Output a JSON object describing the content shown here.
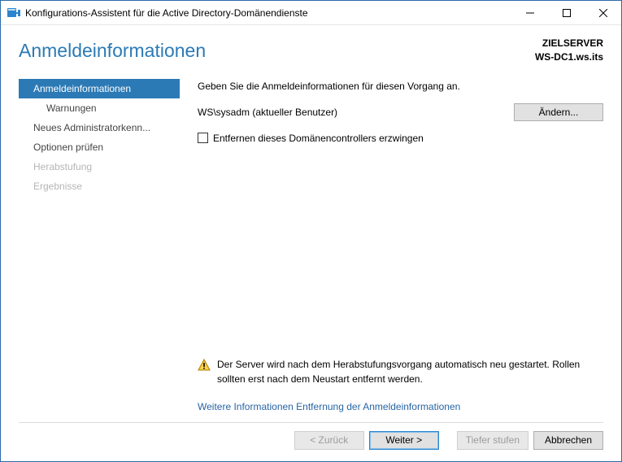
{
  "titlebar": {
    "title": "Konfigurations-Assistent für die Active Directory-Domänendienste"
  },
  "header": {
    "page_title": "Anmeldeinformationen",
    "target_label": "ZIELSERVER",
    "target_value": "WS-DC1.ws.its"
  },
  "sidebar": {
    "items": [
      {
        "label": "Anmeldeinformationen",
        "selected": true,
        "disabled": false,
        "indent": false
      },
      {
        "label": "Warnungen",
        "selected": false,
        "disabled": false,
        "indent": true
      },
      {
        "label": "Neues Administratorkenn...",
        "selected": false,
        "disabled": false,
        "indent": false
      },
      {
        "label": "Optionen prüfen",
        "selected": false,
        "disabled": false,
        "indent": false
      },
      {
        "label": "Herabstufung",
        "selected": false,
        "disabled": true,
        "indent": false
      },
      {
        "label": "Ergebnisse",
        "selected": false,
        "disabled": true,
        "indent": false
      }
    ]
  },
  "main": {
    "intro": "Geben Sie die Anmeldeinformationen für diesen Vorgang an.",
    "credentials_text": "WS\\sysadm (aktueller Benutzer)",
    "change_button": "Ändern...",
    "checkbox_label": "Entfernen dieses Domänencontrollers erzwingen",
    "checkbox_checked": false,
    "warning_text": "Der Server wird nach dem Herabstufungsvorgang automatisch neu gestartet. Rollen sollten erst nach dem Neustart entfernt werden.",
    "more_link": "Weitere Informationen Entfernung der Anmeldeinformationen"
  },
  "buttons": {
    "back": {
      "label": "< Zurück",
      "enabled": false,
      "default": false
    },
    "next": {
      "label": "Weiter >",
      "enabled": true,
      "default": true
    },
    "demote": {
      "label": "Tiefer stufen",
      "enabled": false,
      "default": false
    },
    "cancel": {
      "label": "Abbrechen",
      "enabled": true,
      "default": false
    }
  }
}
